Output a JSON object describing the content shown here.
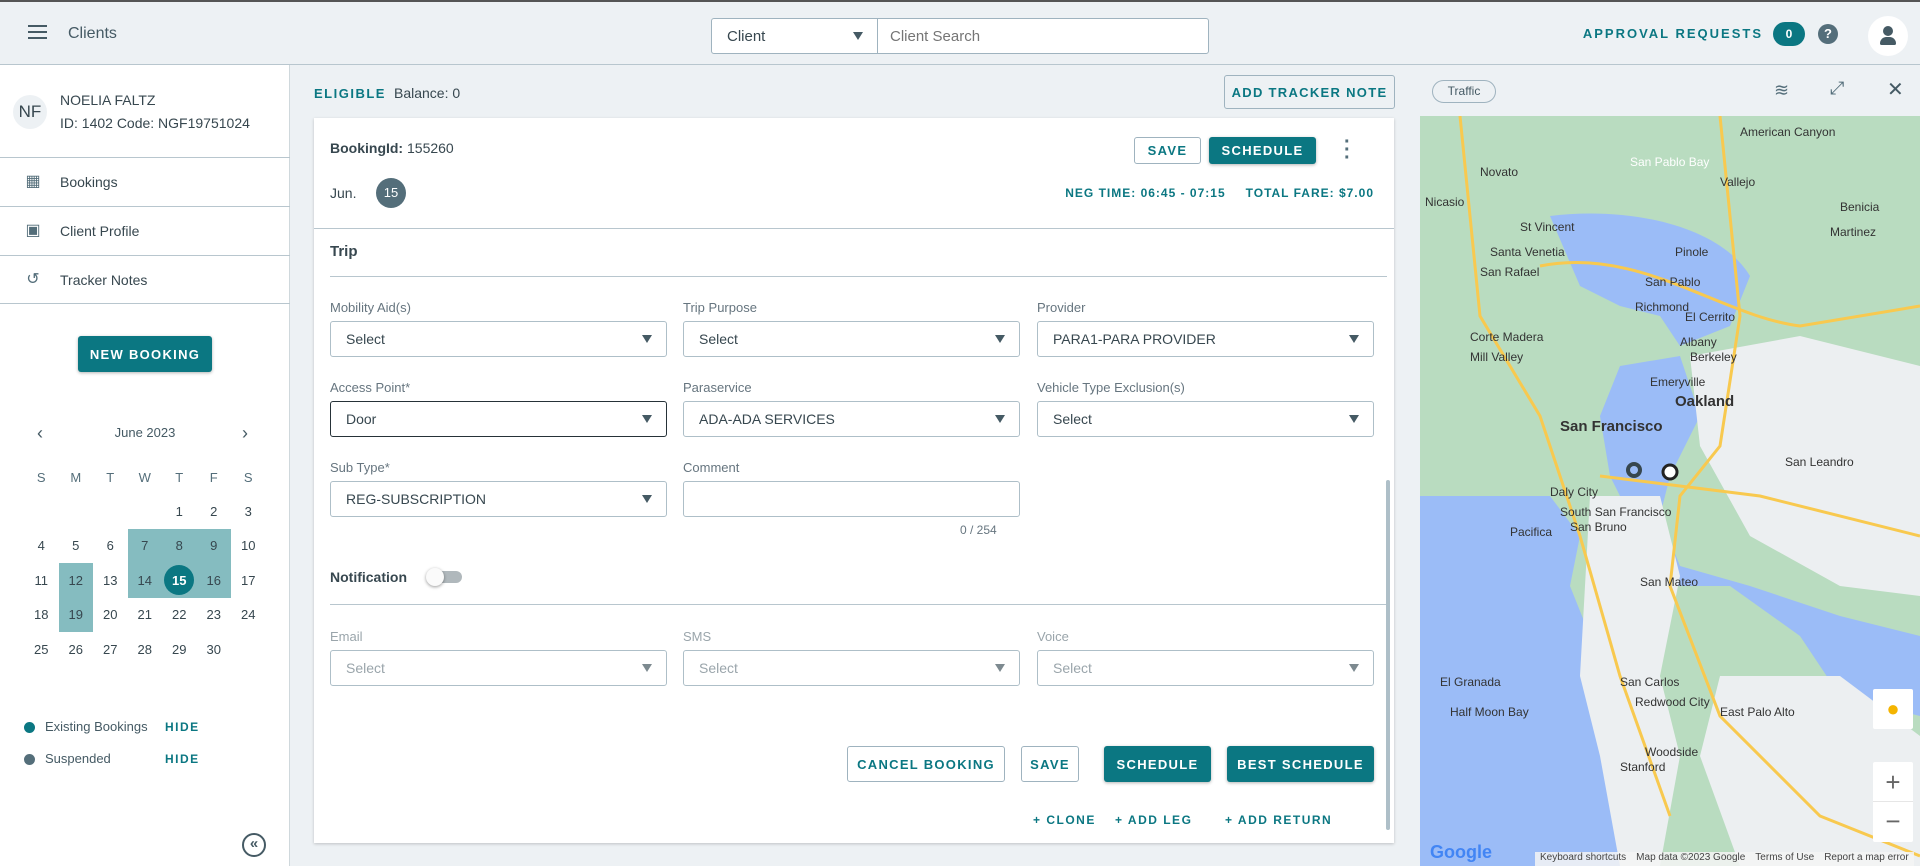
{
  "header": {
    "title": "Clients",
    "search_type": "Client",
    "search_placeholder": "Client Search",
    "approval_label": "APPROVAL REQUESTS",
    "approval_count": "0"
  },
  "client": {
    "initials": "NF",
    "name": "NOELIA FALTZ",
    "id_line": "ID: 1402 Code: NGF19751024"
  },
  "sidebar": {
    "items": [
      {
        "label": "Bookings"
      },
      {
        "label": "Client Profile"
      },
      {
        "label": "Tracker Notes"
      }
    ],
    "new_booking": "NEW BOOKING"
  },
  "calendar": {
    "month": "June 2023",
    "weekdays": [
      "S",
      "M",
      "T",
      "W",
      "T",
      "F",
      "S"
    ],
    "days": [
      "",
      "",
      "",
      "",
      "1",
      "2",
      "3",
      "4",
      "5",
      "6",
      "7",
      "8",
      "9",
      "10",
      "11",
      "12",
      "13",
      "14",
      "15",
      "16",
      "17",
      "18",
      "19",
      "20",
      "21",
      "22",
      "23",
      "24",
      "25",
      "26",
      "27",
      "28",
      "29",
      "30"
    ],
    "highlighted": [
      "7",
      "8",
      "9",
      "12",
      "14",
      "15",
      "16",
      "19"
    ],
    "selected": "15",
    "legend": [
      {
        "label": "Existing Bookings",
        "action": "HIDE",
        "color": "#0b7782"
      },
      {
        "label": "Suspended",
        "action": "HIDE",
        "color": "#546e7a"
      }
    ]
  },
  "status": {
    "eligibility": "ELIGIBLE",
    "balance": "Balance: 0",
    "add_tracker_note": "ADD TRACKER NOTE"
  },
  "booking": {
    "id_label": "BookingId:",
    "id_value": "155260",
    "month": "Jun.",
    "day": "15",
    "save": "SAVE",
    "schedule": "SCHEDULE",
    "neg_time": "NEG TIME: 06:45 - 07:15",
    "total_fare": "TOTAL FARE: $7.00",
    "trip_title": "Trip",
    "fields": {
      "mobility": {
        "label": "Mobility Aid(s)",
        "value": "Select"
      },
      "purpose": {
        "label": "Trip Purpose",
        "value": "Select"
      },
      "provider": {
        "label": "Provider",
        "value": "PARA1-PARA PROVIDER"
      },
      "access": {
        "label": "Access Point*",
        "value": "Door"
      },
      "paraservice": {
        "label": "Paraservice",
        "value": "ADA-ADA SERVICES"
      },
      "vehicle": {
        "label": "Vehicle Type Exclusion(s)",
        "value": "Select"
      },
      "subtype": {
        "label": "Sub Type*",
        "value": "REG-SUBSCRIPTION"
      },
      "comment": {
        "label": "Comment",
        "value": "",
        "counter": "0 / 254"
      }
    },
    "notification_title": "Notification",
    "notify": {
      "email": {
        "label": "Email",
        "value": "Select"
      },
      "sms": {
        "label": "SMS",
        "value": "Select"
      },
      "voice": {
        "label": "Voice",
        "value": "Select"
      }
    },
    "actions": {
      "cancel": "CANCEL BOOKING",
      "save": "SAVE",
      "schedule": "SCHEDULE",
      "best": "BEST SCHEDULE"
    },
    "links": {
      "clone": "+ CLONE",
      "add_leg": "+ ADD LEG",
      "add_return": "+ ADD RETURN"
    }
  },
  "map": {
    "traffic": "Traffic",
    "places": [
      "Novato",
      "Vallejo",
      "American Canyon",
      "Nicasio",
      "San Pablo Bay",
      "Benicia",
      "Martinez",
      "St Vincent",
      "Santa Venetia",
      "Pinole",
      "San Rafael",
      "San Pablo",
      "Richmond",
      "El Cerrito",
      "Corte Madera",
      "Mill Valley",
      "Albany",
      "Berkeley",
      "Emeryville",
      "Oakland",
      "San Francisco",
      "Daly City",
      "South San Francisco",
      "San Bruno",
      "Pacifica",
      "San Mateo",
      "San Leandro",
      "El Granada",
      "Half Moon Bay",
      "San Carlos",
      "Redwood City",
      "Woodside",
      "Stanford",
      "East Palo Alto"
    ],
    "google": "Google",
    "attrib": [
      "Keyboard shortcuts",
      "Map data ©2023 Google",
      "Terms of Use",
      "Report a map error"
    ]
  }
}
